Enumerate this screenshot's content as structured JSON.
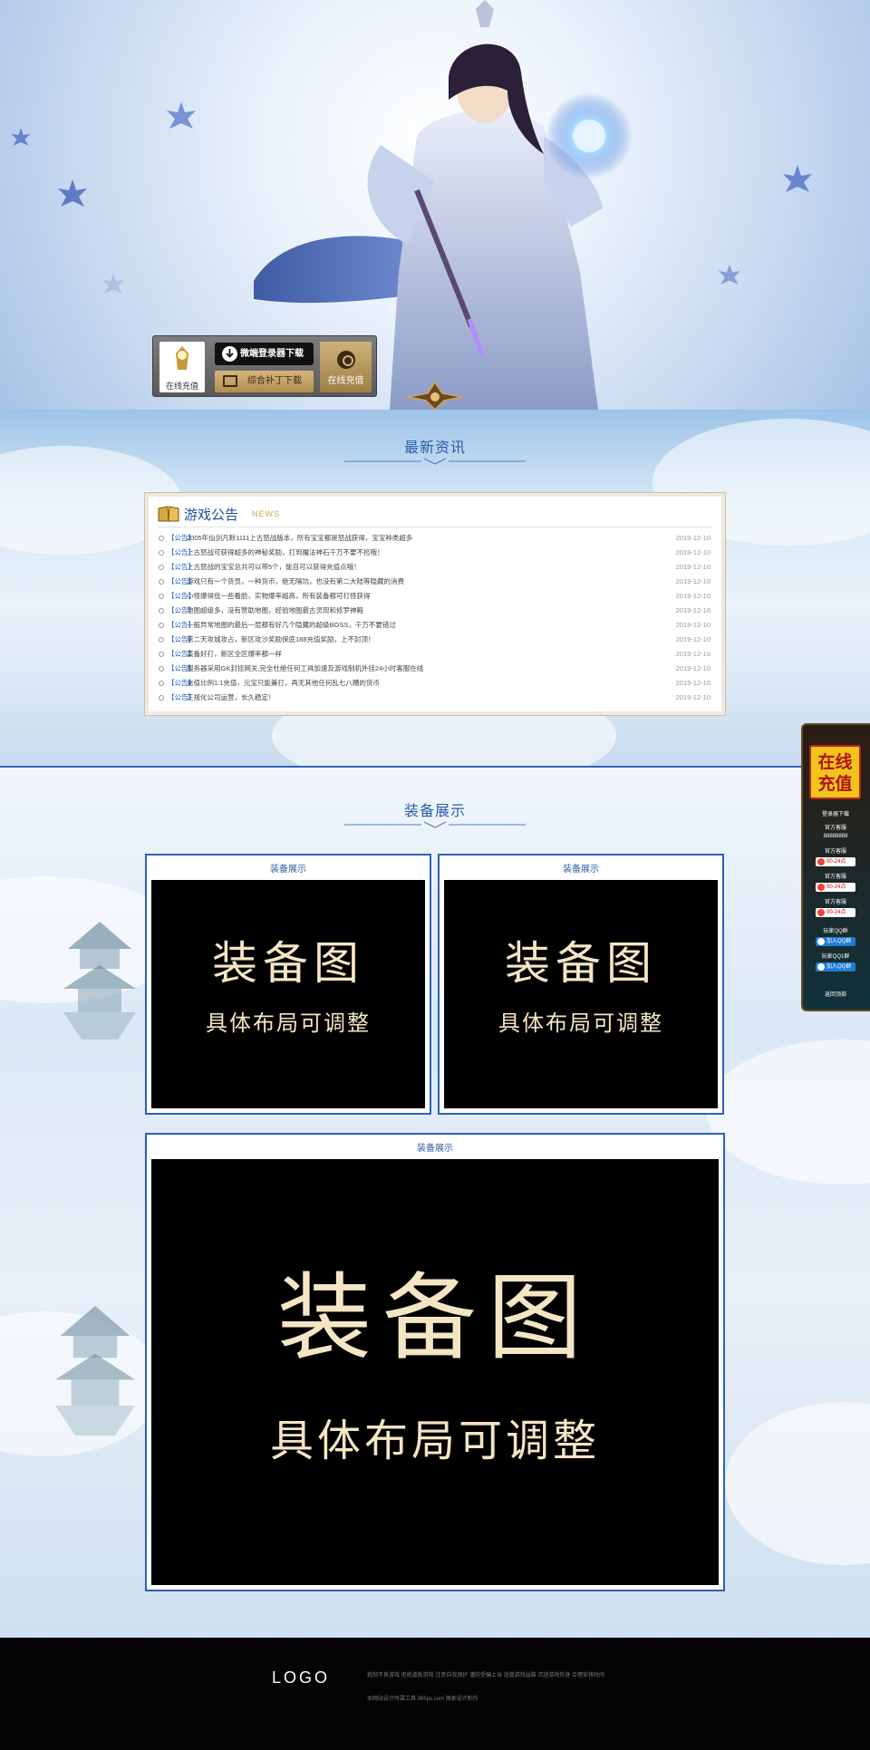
{
  "hero": {
    "download": {
      "recharge_left_label": "在线充值",
      "client_download_label": "微端登录器下载",
      "patch_download_label": "综合补丁下载",
      "recharge_right_label": "在线充值"
    }
  },
  "news": {
    "section_title": "最新资讯",
    "box_title": "游戏公告",
    "box_subtitle": "NEWS",
    "items": [
      {
        "tag": "【公告】",
        "text": "2005年仙剑凡默1111上古怒战版本，所有宝宝都是怒战获得，宝宝种类超多",
        "date": "2019-12-10"
      },
      {
        "tag": "【公告】",
        "text": "上古怒战可获得超多的神秘奖励，打到魔法神石千万不要不捡哦！",
        "date": "2019-12-10"
      },
      {
        "tag": "【公告】",
        "text": "上古怒战的宝宝总共可以带5个，能自可以获得充值点哦！",
        "date": "2019-12-10"
      },
      {
        "tag": "【公告】",
        "text": "游戏只有一个货员，一种货币，绝无隔坑，也没有第二大陆等隐藏的消费",
        "date": "2019-12-10"
      },
      {
        "tag": "【公告】",
        "text": "小怪爆得低一些看脸，实物爆率超高，所有装备都可打怪获得",
        "date": "2019-12-10"
      },
      {
        "tag": "【公告】",
        "text": "地图超级多，没有赞助地图，经验地图最古灵现和修罗神殿",
        "date": "2019-12-10"
      },
      {
        "tag": "【公告】",
        "text": "一般异常地图的最后一层都有好几个隐藏的超级BOSS，千万不要错过",
        "date": "2019-12-10"
      },
      {
        "tag": "【公告】",
        "text": "第二天攻城攻占，新区攻沙奖励保底188充值奖励，上不封顶！",
        "date": "2019-12-10"
      },
      {
        "tag": "【公告】",
        "text": "装备好打，新区全区爆率都一样",
        "date": "2019-12-10"
      },
      {
        "tag": "【公告】",
        "text": "服务器采用GK封挂网关,完全杜绝任何工具加速及游戏制机外挂24小时客服在线",
        "date": "2019-12-10"
      },
      {
        "tag": "【公告】",
        "text": "充值比例1:1充值，元宝只能兼打，再无其他任何乱七八糟的货币",
        "date": "2019-12-10"
      },
      {
        "tag": "【公告】",
        "text": "正规化公司运营，长久稳定！",
        "date": "2019-12-10"
      }
    ]
  },
  "equip": {
    "section_title": "装备展示",
    "cards": [
      {
        "caption": "装备展示",
        "main": "装备图",
        "sub": "具体布局可调整"
      },
      {
        "caption": "装备展示",
        "main": "装备图",
        "sub": "具体布局可调整"
      },
      {
        "caption": "装备展示",
        "main": "装备图",
        "sub": "具体布局可调整"
      }
    ]
  },
  "float_bar": {
    "recharge_line1": "在线",
    "recharge_line2": "充值",
    "login_download": "登录器下载",
    "service_label_1": "官方客服",
    "service_number": "88888888",
    "service_label_2": "官方客服",
    "qq_badge_1": "00-24点",
    "service_label_3": "官方客服",
    "qq_badge_2": "00-24点",
    "service_label_4": "官方客服",
    "qq_badge_3": "00-24点",
    "player_qq_1": "玩家QQ群",
    "join_1": "加入QQ群",
    "player_qq_2": "玩家QQ1群",
    "join_2": "加入QQ群",
    "back_top": "返回顶部"
  },
  "footer": {
    "logo": "LOGO",
    "notice": "抵制不良游戏  拒绝盗版游戏  注意自我保护  谨防受骗上当  适度游戏益脑  沉迷游戏伤身  合理安排时间",
    "copyright": "本网站设计所属工具  365ps.com  独家设计制作"
  },
  "colors": {
    "accent_blue": "#2f60b9",
    "tag_blue": "#1c5bc7",
    "gold": "#c8a35a",
    "footer_bg": "#040404",
    "card_image_text": "#f4e5c4"
  }
}
